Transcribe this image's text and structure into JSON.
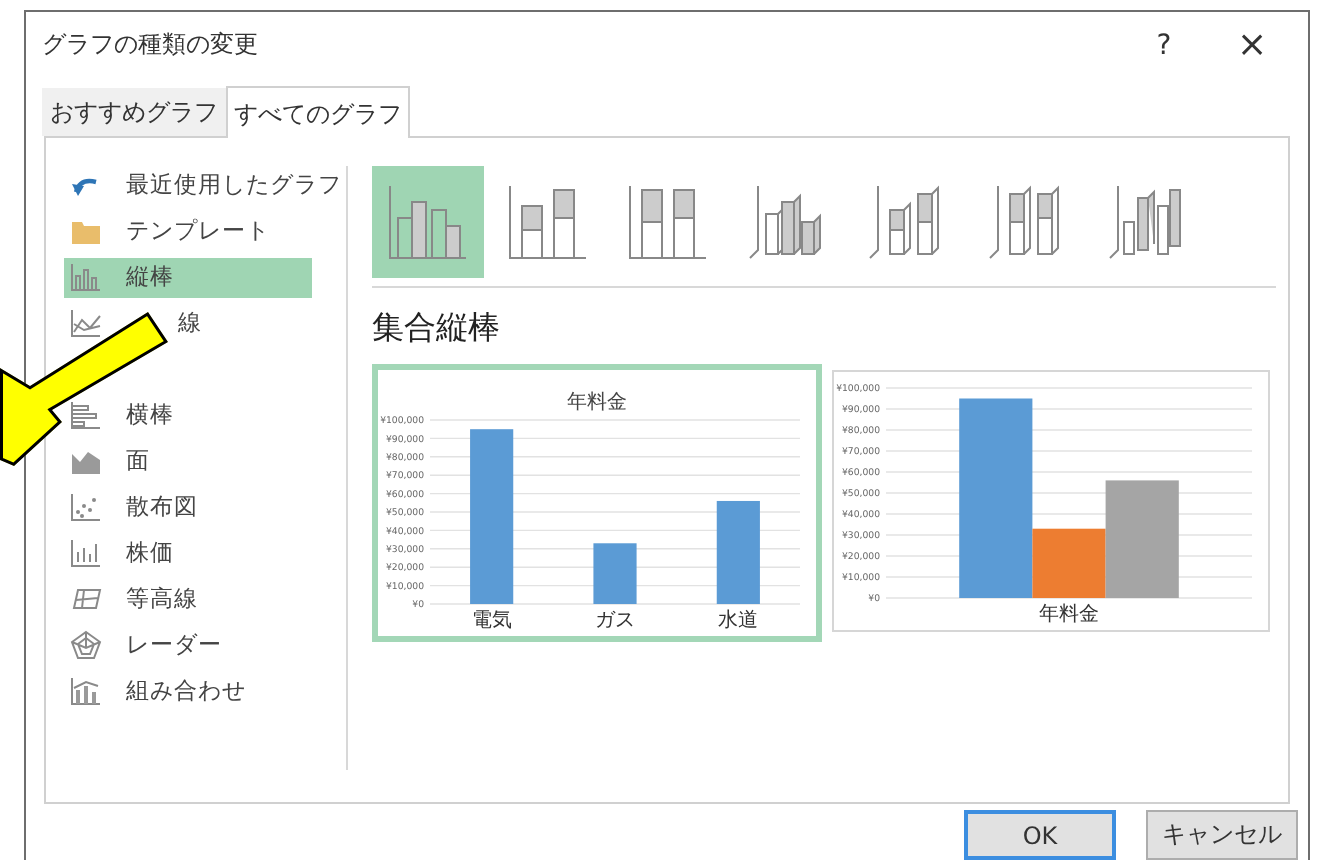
{
  "window": {
    "title": "グラフの種類の変更",
    "help": "?",
    "close": "×"
  },
  "tabs": [
    {
      "label": "おすすめグラフ",
      "selected": false
    },
    {
      "label": "すべてのグラフ",
      "selected": true
    }
  ],
  "sidebar": {
    "items": [
      {
        "kind": "recent",
        "label": "最近使用したグラフ",
        "selected": false
      },
      {
        "kind": "template",
        "label": "テンプレート",
        "selected": false
      },
      {
        "kind": "column",
        "label": "縦棒",
        "selected": true
      },
      {
        "kind": "line",
        "label": "線",
        "selected": false
      },
      {
        "kind": "bar",
        "label": "横棒",
        "selected": false
      },
      {
        "kind": "area",
        "label": "面",
        "selected": false
      },
      {
        "kind": "scatter",
        "label": "散布図",
        "selected": false
      },
      {
        "kind": "stock",
        "label": "株価",
        "selected": false
      },
      {
        "kind": "surface",
        "label": "等高線",
        "selected": false
      },
      {
        "kind": "radar",
        "label": "レーダー",
        "selected": false
      },
      {
        "kind": "combo",
        "label": "組み合わせ",
        "selected": false
      }
    ]
  },
  "subtypes": [
    {
      "kind": "clustered",
      "selected": true
    },
    {
      "kind": "stacked",
      "selected": false
    },
    {
      "kind": "stacked100",
      "selected": false
    },
    {
      "kind": "clustered3d",
      "selected": false
    },
    {
      "kind": "stacked3d",
      "selected": false
    },
    {
      "kind": "stacked100_3d",
      "selected": false
    },
    {
      "kind": "column3d",
      "selected": false
    }
  ],
  "subtype_title": "集合縦棒",
  "previews": [
    {
      "selected": true,
      "chart_data": {
        "type": "bar",
        "grid": true,
        "title": "年料金",
        "categories": [
          "電気",
          "ガス",
          "水道"
        ],
        "series": [
          {
            "color": "#5b9bd5",
            "values": [
              95000,
              33000,
              56000
            ]
          }
        ],
        "ylim": [
          0,
          100000
        ],
        "yticks": [
          {
            "value": 0,
            "label": "¥0"
          },
          {
            "value": 10000,
            "label": "¥10,000"
          },
          {
            "value": 20000,
            "label": "¥20,000"
          },
          {
            "value": 30000,
            "label": "¥30,000"
          },
          {
            "value": 40000,
            "label": "¥40,000"
          },
          {
            "value": 50000,
            "label": "¥50,000"
          },
          {
            "value": 60000,
            "label": "¥60,000"
          },
          {
            "value": 70000,
            "label": "¥70,000"
          },
          {
            "value": 80000,
            "label": "¥80,000"
          },
          {
            "value": 90000,
            "label": "¥90,000"
          },
          {
            "value": 100000,
            "label": "¥100,000"
          }
        ]
      }
    },
    {
      "selected": false,
      "chart_data": {
        "type": "bar",
        "grid": true,
        "categories": [
          "年料金"
        ],
        "series": [
          {
            "color": "#5b9bd5",
            "values": [
              95000
            ]
          },
          {
            "color": "#ed7d31",
            "values": [
              33000
            ]
          },
          {
            "color": "#a5a5a5",
            "values": [
              56000
            ]
          }
        ],
        "ylim": [
          0,
          100000
        ],
        "yticks": [
          {
            "value": 0,
            "label": "¥0"
          },
          {
            "value": 10000,
            "label": "¥10,000"
          },
          {
            "value": 20000,
            "label": "¥20,000"
          },
          {
            "value": 30000,
            "label": "¥30,000"
          },
          {
            "value": 40000,
            "label": "¥40,000"
          },
          {
            "value": 50000,
            "label": "¥50,000"
          },
          {
            "value": 60000,
            "label": "¥60,000"
          },
          {
            "value": 70000,
            "label": "¥70,000"
          },
          {
            "value": 80000,
            "label": "¥80,000"
          },
          {
            "value": 90000,
            "label": "¥90,000"
          },
          {
            "value": 100000,
            "label": "¥100,000"
          }
        ]
      }
    }
  ],
  "buttons": [
    {
      "label": "OK",
      "default": true
    },
    {
      "label": "キャンセル",
      "default": false
    }
  ],
  "annotation": {
    "kind": "arrow"
  }
}
